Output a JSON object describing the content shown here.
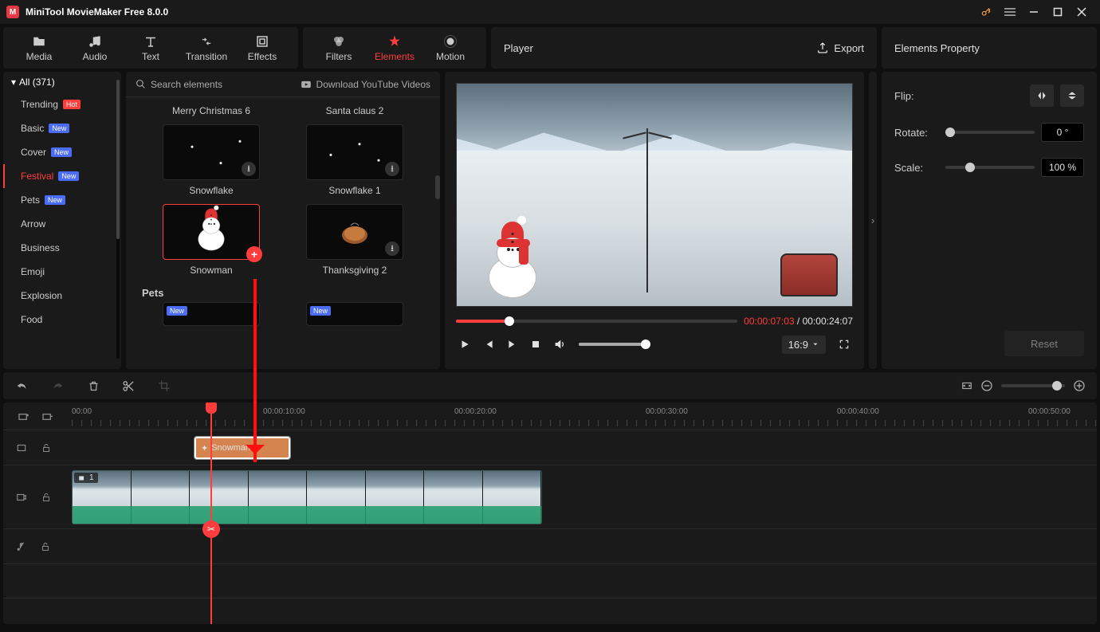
{
  "app": {
    "title": "MiniTool MovieMaker Free 8.0.0"
  },
  "toolbar": {
    "media": "Media",
    "audio": "Audio",
    "text": "Text",
    "transition": "Transition",
    "effects": "Effects",
    "filters": "Filters",
    "elements": "Elements",
    "motion": "Motion"
  },
  "player_label": "Player",
  "export_label": "Export",
  "props_label": "Elements Property",
  "sidebar": {
    "all": "All (371)",
    "items": [
      {
        "label": "Trending",
        "badge": "Hot"
      },
      {
        "label": "Basic",
        "badge": "New"
      },
      {
        "label": "Cover",
        "badge": "New"
      },
      {
        "label": "Festival",
        "badge": "New",
        "active": true
      },
      {
        "label": "Pets",
        "badge": "New"
      },
      {
        "label": "Arrow"
      },
      {
        "label": "Business"
      },
      {
        "label": "Emoji"
      },
      {
        "label": "Explosion"
      },
      {
        "label": "Food"
      }
    ]
  },
  "gallery": {
    "search_ph": "Search elements",
    "yt_link": "Download YouTube Videos",
    "row0": [
      "Merry Christmas 6",
      "Santa claus 2"
    ],
    "row1": [
      "Snowflake",
      "Snowflake 1"
    ],
    "row2": [
      "Snowman",
      "Thanksgiving 2"
    ],
    "section_pets": "Pets",
    "new_badge": "New"
  },
  "player": {
    "current": "00:00:07:03",
    "total": "00:00:24:07",
    "sep": " / ",
    "ratio": "16:9"
  },
  "props": {
    "flip": "Flip:",
    "rotate": "Rotate:",
    "rotate_val": "0 °",
    "scale": "Scale:",
    "scale_val": "100 %",
    "reset": "Reset"
  },
  "timeline": {
    "marks": [
      "00:00",
      "00:00:10:00",
      "00:00:20:00",
      "00:00:30:00",
      "00:00:40:00",
      "00:00:50:00"
    ],
    "clip_element": "Snowman",
    "clip_video_num": "1"
  }
}
